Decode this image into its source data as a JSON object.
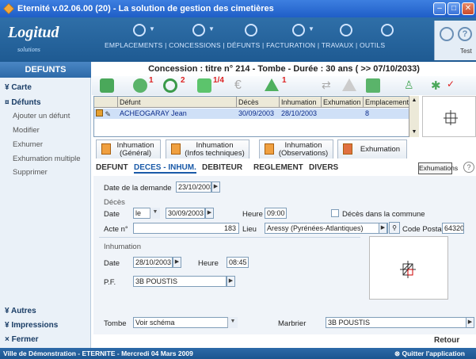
{
  "window": {
    "title": "Eternité v.02.06.00 (20) - La solution de gestion des cimetières"
  },
  "logo": {
    "text": "Logitud",
    "subtext": "solutions"
  },
  "nav": {
    "menu": "EMPLACEMENTS | CONCESSIONS | DÉFUNTS | FACTURATION | TRAVAUX | OUTILS",
    "test_label": "Test"
  },
  "sidebar": {
    "title": "DEFUNTS",
    "sections": [
      {
        "label": "¥ Carte"
      },
      {
        "label": "¤ Défunts"
      }
    ],
    "items": [
      "Ajouter un défunt",
      "Modifier",
      "Exhumer",
      "Exhumation multiple",
      "Supprimer"
    ],
    "bottom": [
      "¥ Autres",
      "¥ Impressions",
      "× Fermer"
    ]
  },
  "concession": {
    "title": "Concession : titre n° 214 - Tombe - Durée : 30 ans ( >> 07/10/2033)"
  },
  "toolbar": {
    "badges": [
      "1",
      "2",
      "1/4",
      "1"
    ]
  },
  "grid": {
    "headers": [
      "Défunt",
      "Décès",
      "Inhumation",
      "Exhumation",
      "Emplacement"
    ],
    "rows": [
      {
        "defunt": "ACHEOGARAY Jean",
        "deces": "30/09/2003",
        "inhumation": "28/10/2003",
        "exhumation": "",
        "emplacement": "8"
      }
    ]
  },
  "tabs": [
    {
      "line1": "Inhumation",
      "line2": "(Général)"
    },
    {
      "line1": "Inhumation",
      "line2": "(Infos techniques)"
    },
    {
      "line1": "Inhumation",
      "line2": "(Observations)"
    },
    {
      "line1": "Exhumation",
      "line2": ""
    }
  ],
  "subtabs": [
    "DEFUNT",
    "DECES - INHUM.",
    "DEBITEUR",
    "REGLEMENT",
    "DIVERS"
  ],
  "exhumations_btn": "Exhumations",
  "form": {
    "date_demande_label": "Date de la demande",
    "date_demande": "23/10/2003",
    "deces_group": "Décès",
    "date_label": "Date",
    "date_prefix": "le",
    "date_deces": "30/09/2003",
    "heure_label": "Heure",
    "heure_deces": "09:00",
    "commune_label": "Décès dans la commune",
    "acte_label": "Acte n°",
    "acte_value": "183",
    "lieu_label": "Lieu",
    "lieu_value": "Aressy (Pyrénées-Atlantiques)",
    "cp_label": "Code Postal",
    "cp_value": "64320",
    "inhumation_group": "Inhumation",
    "date_inhum": "28/10/2003",
    "heure_inhum": "08:45",
    "pf_label": "P.F.",
    "pf_value": "3B POUSTIS",
    "tombe_label": "Tombe",
    "tombe_value": "Voir schéma",
    "marbrier_label": "Marbrier",
    "marbrier_value": "3B POUSTIS"
  },
  "retour": "Retour",
  "status": {
    "left": "Ville de Démonstration - ETERNITE - Mercredi 04 Mars 2009",
    "quit": "Quitter l'application"
  }
}
